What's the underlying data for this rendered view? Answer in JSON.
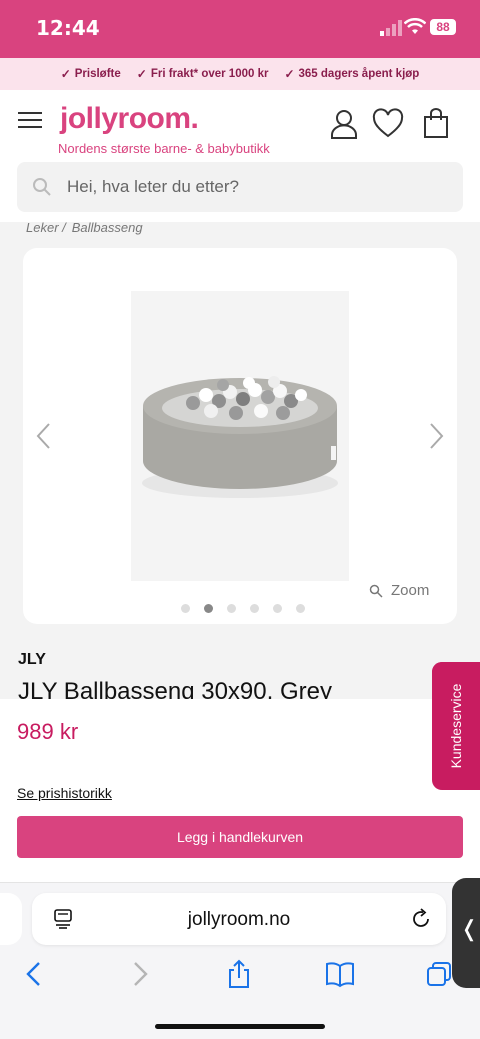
{
  "status": {
    "time": "12:44",
    "battery": "88"
  },
  "promo": [
    {
      "check": "✓",
      "label": "Prisløfte"
    },
    {
      "check": "✓",
      "label": "Fri frakt* over 1000 kr"
    },
    {
      "check": "✓",
      "label": "365 dagers åpent kjøp"
    }
  ],
  "header": {
    "logo": "jollyroom.",
    "tagline": "Nordens største barne- & babybutikk",
    "search_placeholder": "Hei, hva leter du etter?"
  },
  "breadcrumb": [
    "Leker /",
    "Ballbasseng"
  ],
  "gallery": {
    "zoom_label": "Zoom",
    "dots": 6,
    "active_dot": 1
  },
  "product": {
    "brand": "JLY",
    "title": "JLY Ballbasseng 30x90, Grey",
    "price": "989 kr",
    "price_history": "Se prishistorikk",
    "add_to_cart": "Legg i handlekurven"
  },
  "customer_service": "Kundeservice",
  "browser": {
    "url": "jollyroom.no"
  },
  "colors": {
    "brand_pink": "#d9437f",
    "dark_pink": "#c81c60",
    "promo_bg": "#fbe3ec",
    "ios_blue": "#1a73e8"
  }
}
